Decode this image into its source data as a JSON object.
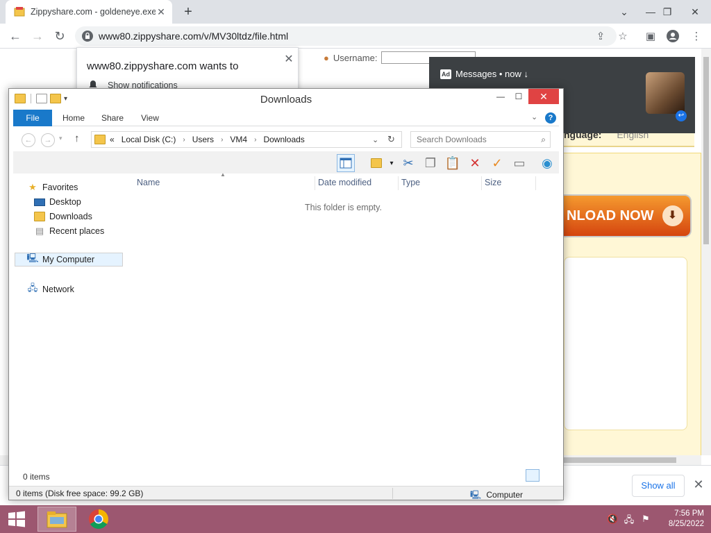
{
  "browser": {
    "tab_title": "Zippyshare.com - goldeneye.exe",
    "url": "www80.zippyshare.com/v/MV30ltdz/file.html",
    "download_bar": {
      "show_all": "Show all"
    }
  },
  "notification_prompt": {
    "message": "www80.zippyshare.com wants to",
    "action": "Show notifications"
  },
  "ad_toast": {
    "tag": "Ad",
    "title": "Messages • now ↓"
  },
  "webpage": {
    "username_label": "Username:",
    "language_label": "nguage:",
    "language_value": "English",
    "download_button": "NLOAD NOW"
  },
  "explorer": {
    "title": "Downloads",
    "ribbon_tabs": [
      "File",
      "Home",
      "Share",
      "View"
    ],
    "breadcrumb": [
      "Local Disk (C:)",
      "Users",
      "VM4",
      "Downloads"
    ],
    "search_placeholder": "Search Downloads",
    "nav": {
      "favorites": "Favorites",
      "desktop": "Desktop",
      "downloads": "Downloads",
      "recent": "Recent places",
      "computer": "My Computer",
      "network": "Network"
    },
    "columns": [
      "Name",
      "Date modified",
      "Type",
      "Size"
    ],
    "empty_message": "This folder is empty.",
    "item_count": "0 items",
    "status_left": "0 items (Disk free space: 99.2 GB)",
    "status_right": "Computer"
  },
  "taskbar": {
    "time": "7:56 PM",
    "date": "8/25/2022"
  }
}
